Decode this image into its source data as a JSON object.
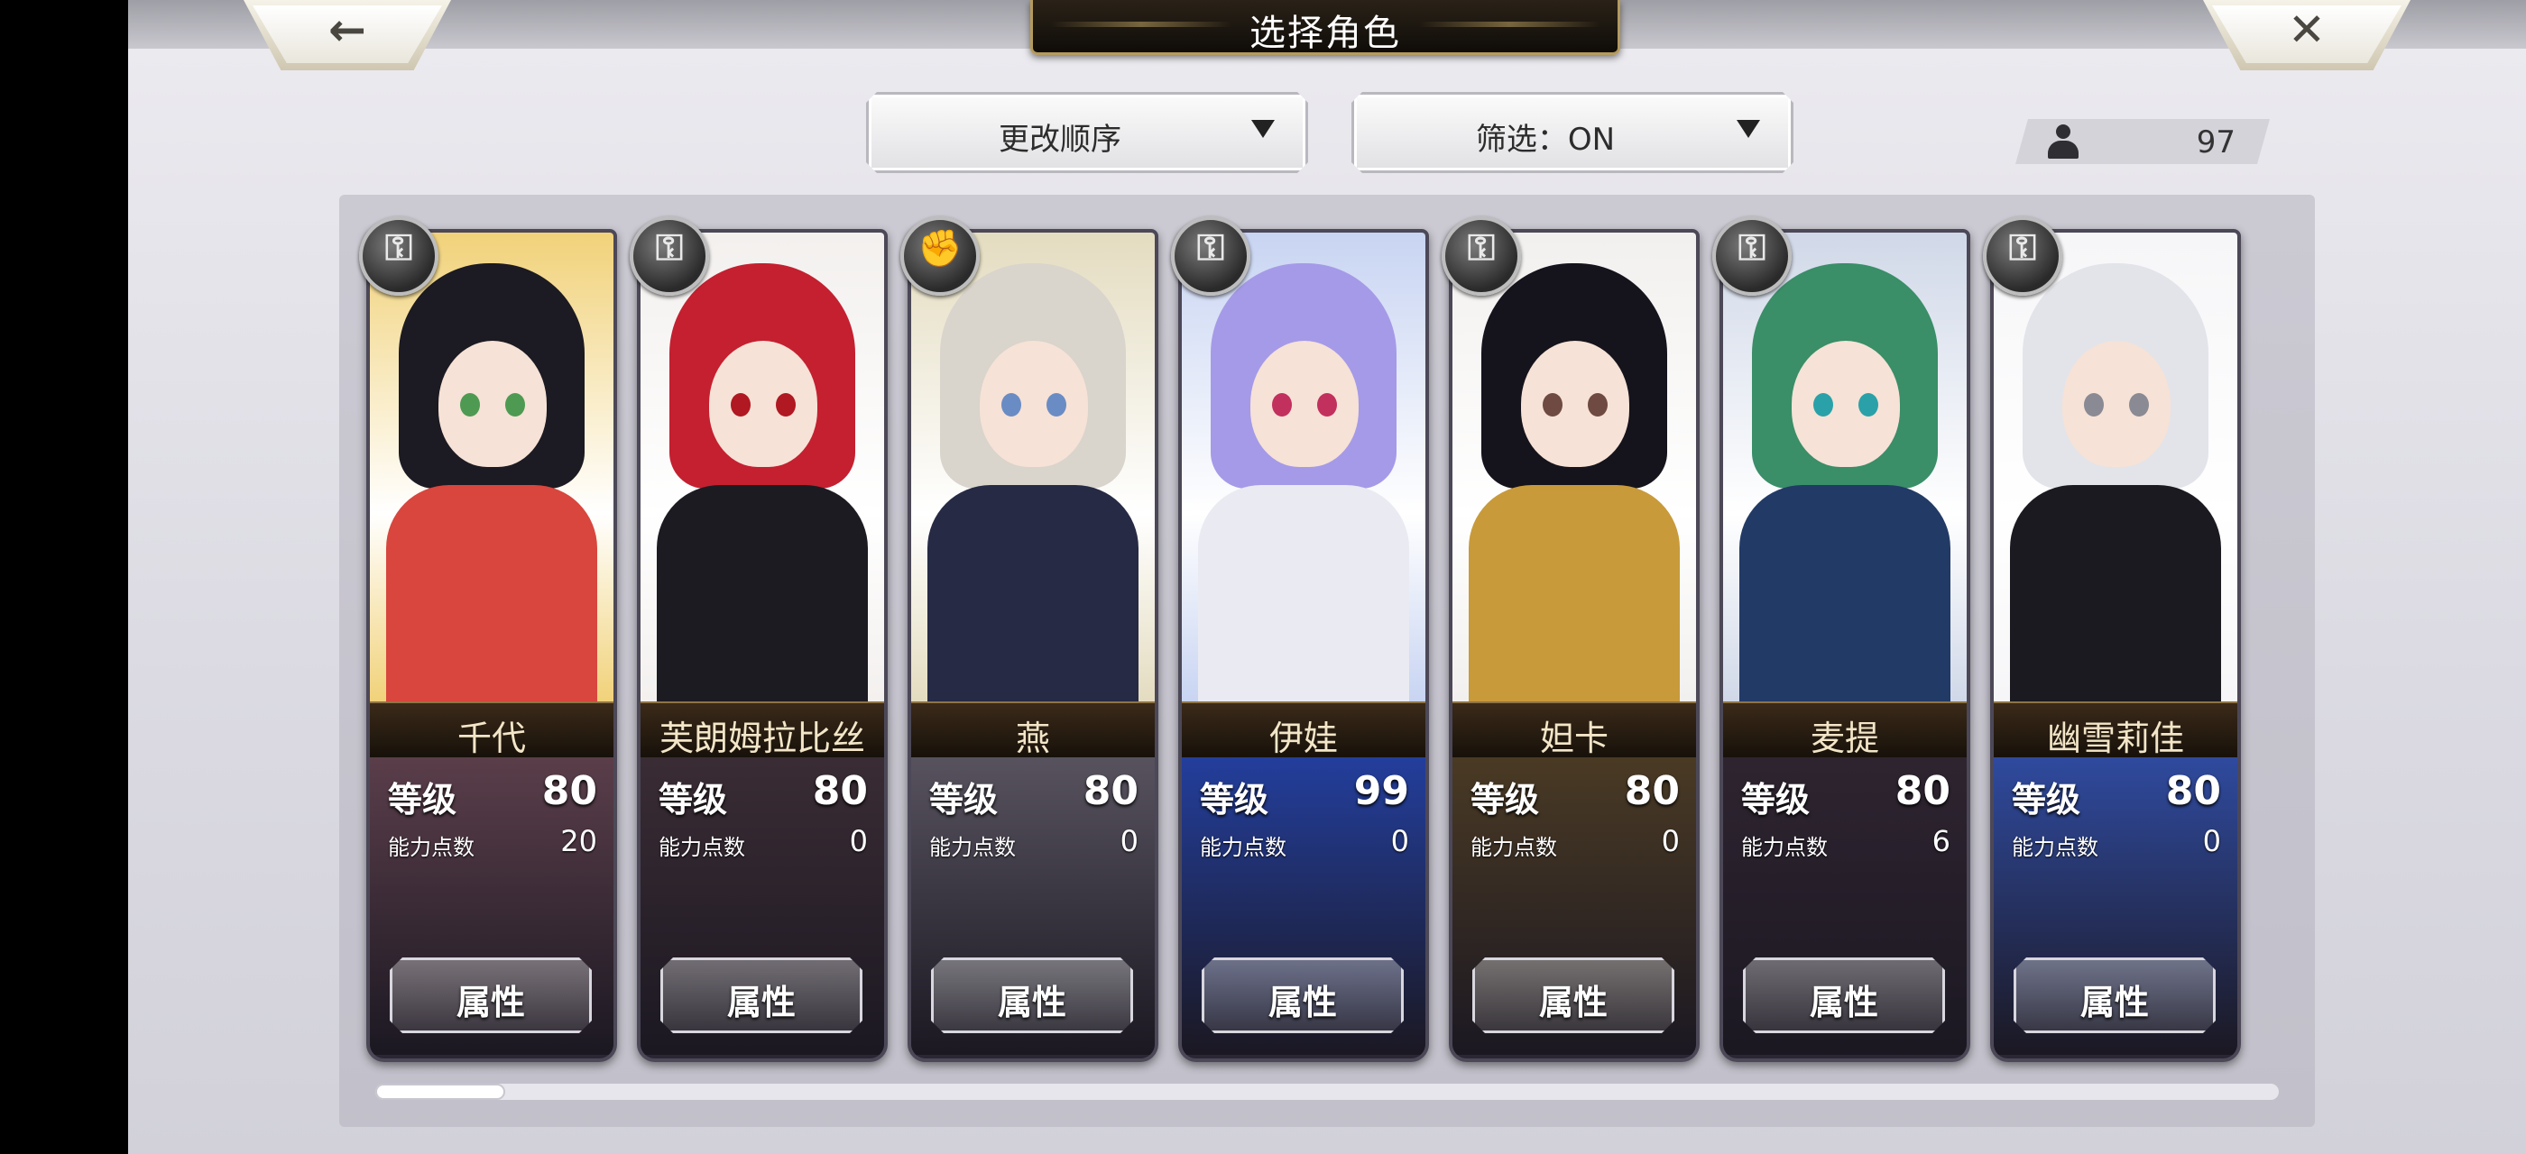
{
  "header": {
    "title": "选择角色",
    "back_icon": "←",
    "close_icon": "✕"
  },
  "controls": {
    "sort_label": "更改顺序",
    "filter_label": "筛选：ON",
    "character_count": "97"
  },
  "card_labels": {
    "level": "等级",
    "ability_points": "能力点数",
    "attributes_button": "属性"
  },
  "characters": [
    {
      "name": "千代",
      "level": "80",
      "ability_points": "20",
      "type_icon": "key-icon",
      "hair": "#1c1a22",
      "eye": "#4e9a52",
      "outfit": "#d8463e",
      "bg": "#f1d27a",
      "stats_bg": "#5a3e4a"
    },
    {
      "name": "芙朗姆拉比丝",
      "level": "80",
      "ability_points": "0",
      "type_icon": "key-icon",
      "hair": "#c42030",
      "eye": "#b01822",
      "outfit": "#1d1b22",
      "bg": "#f3f0ee",
      "stats_bg": "#3a2c34"
    },
    {
      "name": "燕",
      "level": "80",
      "ability_points": "0",
      "type_icon": "fist-icon",
      "hair": "#d9d4cc",
      "eye": "#6a8cc4",
      "outfit": "#262a44",
      "bg": "#e4dcc0",
      "stats_bg": "#57525e"
    },
    {
      "name": "伊娃",
      "level": "99",
      "ability_points": "0",
      "type_icon": "key-icon",
      "hair": "#a59ae8",
      "eye": "#c2305e",
      "outfit": "#eaeaf2",
      "bg": "#c8d4f2",
      "stats_bg": "#233e9c"
    },
    {
      "name": "妲卡",
      "level": "80",
      "ability_points": "0",
      "type_icon": "key-icon",
      "hair": "#15131c",
      "eye": "#6e4a42",
      "outfit": "#c89a3a",
      "bg": "#f2f0ee",
      "stats_bg": "#4a3a24"
    },
    {
      "name": "麦提",
      "level": "80",
      "ability_points": "6",
      "type_icon": "key-icon",
      "hair": "#3a8e68",
      "eye": "#2aa1a8",
      "outfit": "#223a66",
      "bg": "#d0d8e8",
      "stats_bg": "#2e2430"
    },
    {
      "name": "幽雪莉佳",
      "level": "80",
      "ability_points": "0",
      "type_icon": "key-icon",
      "hair": "#e2e4ea",
      "eye": "#8a8a94",
      "outfit": "#1a1a20",
      "bg": "#f6f6f8",
      "stats_bg": "#2f4a9e"
    }
  ],
  "colors": {
    "title_plate": "#1a140d",
    "gold_trim": "#b49a5d",
    "roster_panel": "#b4b2be"
  }
}
